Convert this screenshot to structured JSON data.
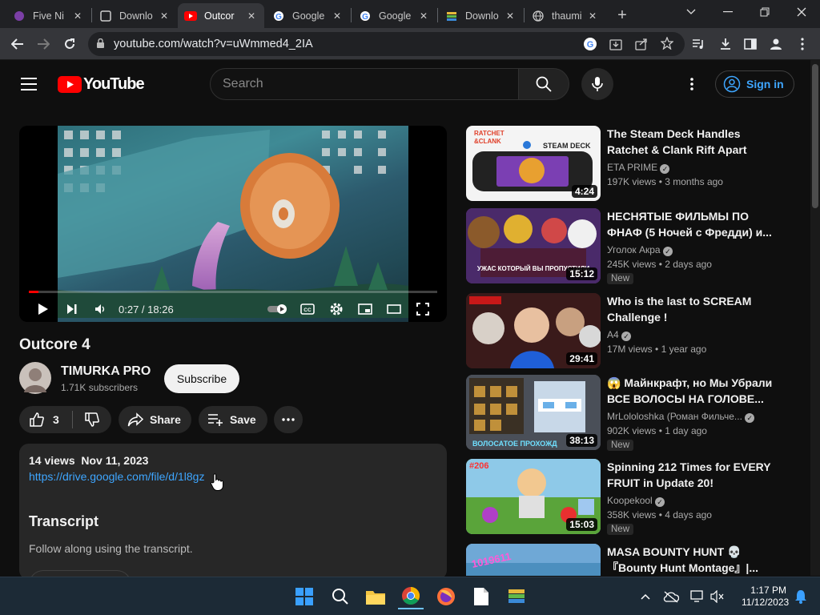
{
  "browser": {
    "tabs": [
      {
        "title": "Five Ni",
        "favicon": "five-nights-icon",
        "active": false
      },
      {
        "title": "Downlo",
        "favicon": "download-page-icon",
        "active": false
      },
      {
        "title": "Outcor",
        "favicon": "youtube-icon",
        "active": true
      },
      {
        "title": "Google",
        "favicon": "google-icon",
        "active": false
      },
      {
        "title": "Google",
        "favicon": "google-icon",
        "active": false
      },
      {
        "title": "Downlo",
        "favicon": "bluestacks-icon",
        "active": false
      },
      {
        "title": "thaumi",
        "favicon": "globe-icon",
        "active": false
      }
    ],
    "new_tab": "+",
    "url": "youtube.com/watch?v=uWmmed4_2IA"
  },
  "youtube": {
    "logo": "YouTube",
    "search_placeholder": "Search",
    "sign_in": "Sign in"
  },
  "video": {
    "time": "0:27 / 18:26",
    "progress": 0.024,
    "title": "Outcore 4",
    "channel": "TIMURKA PRO",
    "subscribers": "1.71K subscribers",
    "subscribe": "Subscribe",
    "likes": "3",
    "share": "Share",
    "save": "Save"
  },
  "description": {
    "views": "14 views",
    "date": "Nov 11, 2023",
    "link": "https://drive.google.com/file/d/1l8gz",
    "transcript_heading": "Transcript",
    "transcript_text": "Follow along using the transcript."
  },
  "recommendations": [
    {
      "title": "The Steam Deck Handles Ratchet & Clank Rift Apart Lik...",
      "channel": "ETA PRIME",
      "verified": true,
      "views": "197K views",
      "age": "3 months ago",
      "duration": "4:24",
      "new": "",
      "thumb_text": "STEAM DECK",
      "thumb_color": "#ffffff"
    },
    {
      "title": "НЕСНЯТЫЕ ФИЛЬМЫ ПО ФНАФ (5 Ночей с Фредди) и...",
      "channel": "Уголок Акра",
      "verified": true,
      "views": "245K views",
      "age": "2 days ago",
      "duration": "15:12",
      "new": "New",
      "thumb_text": "УЖАС КОТОРЫЙ ВЫ ПРОПУСТИЛИ",
      "thumb_color": "#6b3b8c"
    },
    {
      "title": "Who is the last to SCREAM Challenge !",
      "channel": "A4",
      "verified": true,
      "views": "17M views",
      "age": "1 year ago",
      "duration": "29:41",
      "new": "",
      "thumb_text": "",
      "thumb_color": "#3a1a1a"
    },
    {
      "title": "😱 Майнкрафт, но Мы Убрали ВСЕ ВОЛОСЫ НА ГОЛОВЕ...",
      "channel": "MrLololoshka (Роман Фильче...",
      "verified": true,
      "views": "902K views",
      "age": "1 day ago",
      "duration": "38:13",
      "new": "New",
      "thumb_text": "ВОЛОСАТОЕ ПРОХОЖД",
      "thumb_color": "#4a4f58"
    },
    {
      "title": "Spinning 212 Times for EVERY FRUIT in Update 20!",
      "channel": "Koopekool",
      "verified": true,
      "views": "358K views",
      "age": "4 days ago",
      "duration": "15:03",
      "new": "New",
      "thumb_text": "#206",
      "thumb_color": "#5aa43a"
    },
    {
      "title": "MASA BOUNTY HUNT 💀 『Bounty Hunt Montage』|...",
      "channel": "",
      "verified": false,
      "views": "",
      "age": "",
      "duration": "",
      "new": "",
      "thumb_text": "1019611",
      "thumb_color": "#6fa8d6"
    }
  ],
  "taskbar": {
    "time": "1:17 PM",
    "date": "11/12/2023"
  },
  "colors": {
    "accent_link": "#3ea6ff",
    "youtube_red": "#ff0000",
    "background": "#0f0f0f"
  }
}
